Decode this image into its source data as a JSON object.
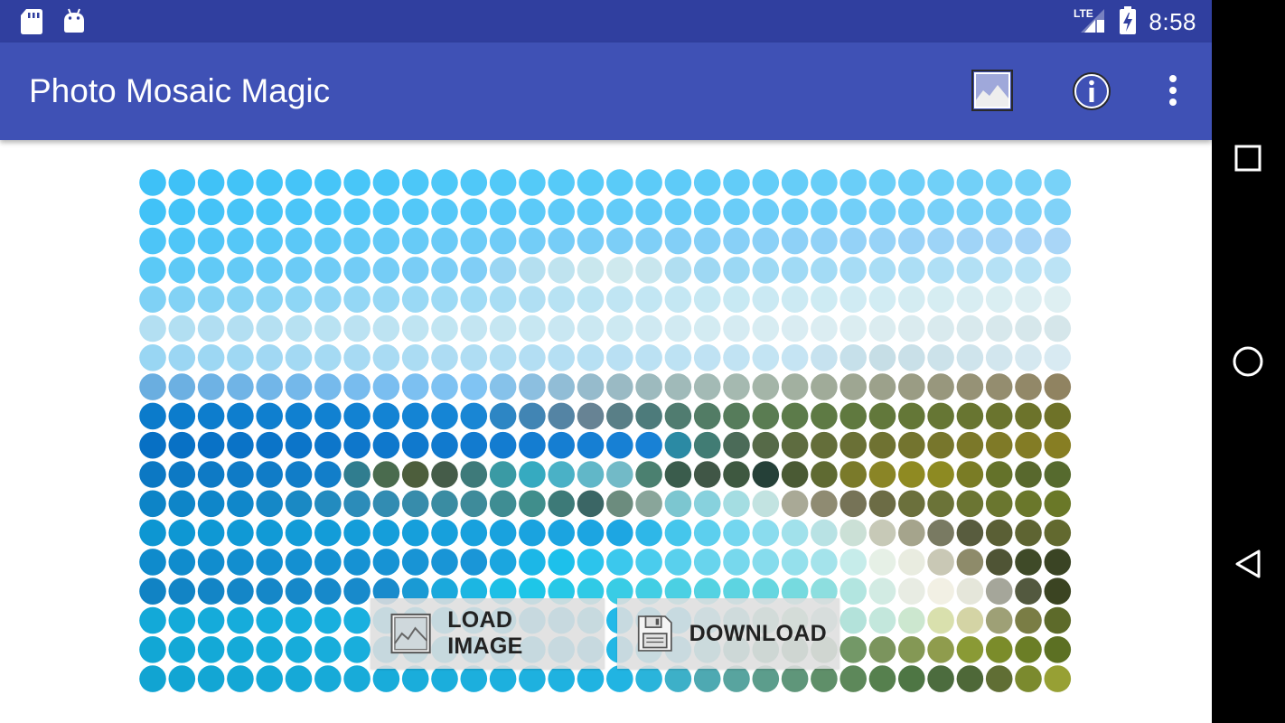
{
  "status_bar": {
    "time": "8:58",
    "network_label": "LTE",
    "icons": [
      "sd-card-icon",
      "android-icon",
      "lte-signal-icon",
      "battery-charging-icon"
    ]
  },
  "app_bar": {
    "title": "Photo Mosaic Magic",
    "actions": [
      "image-icon",
      "info-icon",
      "overflow-menu-icon"
    ]
  },
  "actions": {
    "load_image_label": "LOAD IMAGE",
    "download_label": "DOWNLOAD"
  },
  "nav_bar": {
    "buttons": [
      "recents-square-icon",
      "home-circle-icon",
      "back-triangle-icon"
    ]
  },
  "colors": {
    "primary": "#3f51b5",
    "primary_dark": "#303f9f",
    "nav_background": "#000000",
    "button_background": "#dedede",
    "button_text": "#222222"
  },
  "mosaic": {
    "columns": 32,
    "rows": 18,
    "color_rows": [
      [
        "#3ec1f7",
        "#3fc1f7",
        "#40c2f7",
        "#42c3f7",
        "#44c4f7",
        "#45c4f8",
        "#46c5f8",
        "#48c6f8",
        "#4ac6f8",
        "#4cc7f8",
        "#4ec8f8",
        "#50c8f8",
        "#52c9f8",
        "#54caf8",
        "#56caf8",
        "#58cbf8",
        "#5acbf8",
        "#5ccbf8",
        "#5ecbf8",
        "#60ccf8",
        "#62ccf8",
        "#64cdf8",
        "#66cdf8",
        "#68cef8",
        "#6acef8",
        "#6ccff8",
        "#6ecff8",
        "#70d0f8",
        "#72d0f8",
        "#74d1f8",
        "#76d1f8",
        "#78d2f8"
      ],
      [
        "#41c2f7",
        "#43c3f7",
        "#45c3f7",
        "#47c4f7",
        "#49c5f7",
        "#4bc5f8",
        "#4dc6f8",
        "#4fc7f8",
        "#51c7f8",
        "#53c8f8",
        "#56c8f8",
        "#58c9f8",
        "#5ac9f8",
        "#5ccaf8",
        "#5ecaf8",
        "#60cbf8",
        "#62cbf8",
        "#64cbf8",
        "#66ccf8",
        "#68ccf8",
        "#6acdf8",
        "#6ccdf8",
        "#6ecef8",
        "#70cef8",
        "#72cff8",
        "#74cff8",
        "#76d0f8",
        "#78d0f8",
        "#7ad1f8",
        "#7cd1f8",
        "#7ed2f8",
        "#80d2f8"
      ],
      [
        "#4dc5f7",
        "#4fc6f7",
        "#52c6f7",
        "#55c7f7",
        "#58c8f7",
        "#5bc8f7",
        "#5ec9f7",
        "#61caf7",
        "#64caf7",
        "#67cbf7",
        "#6acbf7",
        "#6dccf7",
        "#70ccf7",
        "#73cdf7",
        "#76cdf7",
        "#79cef7",
        "#7ccef7",
        "#7fcff7",
        "#82cff7",
        "#85d0f7",
        "#88d0f7",
        "#8bd1f7",
        "#8ed1f7",
        "#91d2f7",
        "#94d2f7",
        "#97d3f7",
        "#9ad3f7",
        "#9dd4f7",
        "#a0d4f7",
        "#a3d5f7",
        "#a6d5f7",
        "#a9d6f7"
      ],
      [
        "#5bc9f6",
        "#5ec9f6",
        "#61caf6",
        "#64caf6",
        "#68cbf6",
        "#6bcbf6",
        "#6fccf6",
        "#72ccf6",
        "#75cdf6",
        "#79cdf6",
        "#7ccef6",
        "#80cef6",
        "#9ad6f3",
        "#b4dff0",
        "#bfe3ef",
        "#c9e7ee",
        "#cfe9ee",
        "#c8e6ee",
        "#b0def1",
        "#9ed8f3",
        "#9bd8f4",
        "#9dd9f4",
        "#a0daf5",
        "#a3dbf5",
        "#a6dcf5",
        "#a9ddf5",
        "#acdef5",
        "#afdff5",
        "#b2e0f5",
        "#b5e1f5",
        "#b8e2f5",
        "#bbe3f5"
      ],
      [
        "#7fd1f5",
        "#82d2f5",
        "#85d3f5",
        "#88d4f5",
        "#8bd5f5",
        "#8ed6f5",
        "#91d6f5",
        "#94d7f5",
        "#97d8f5",
        "#9ad9f5",
        "#9ddaf5",
        "#a0dbf5",
        "#a8ddf4",
        "#b0dff3",
        "#b7e2f3",
        "#bce4f3",
        "#c0e5f3",
        "#c2e6f3",
        "#c4e7f3",
        "#c6e8f3",
        "#c8e9f3",
        "#cae9f3",
        "#cceaf3",
        "#ceebf3",
        "#d0ebf3",
        "#d2ecf3",
        "#d4ecf2",
        "#d6edf2",
        "#d8edf2",
        "#daeef2",
        "#dceef2",
        "#deeff2"
      ],
      [
        "#b3dff2",
        "#b2dff2",
        "#b1def2",
        "#b3dff2",
        "#b5e0f2",
        "#b7e1f2",
        "#b9e2f2",
        "#bbe2f2",
        "#bde3f2",
        "#bfe4f2",
        "#c1e5f2",
        "#c3e5f2",
        "#c5e6f2",
        "#c7e7f2",
        "#c9e7f2",
        "#cbe8f2",
        "#cde9f2",
        "#cfe9f2",
        "#d1eaf2",
        "#d3ebf2",
        "#d5ebf2",
        "#d7ecf2",
        "#d9ecf2",
        "#dbedf2",
        "#dbedf1",
        "#dbecf0",
        "#daebef",
        "#d9eaee",
        "#d8e9ed",
        "#d7e8ec",
        "#d6e7eb",
        "#d5e6ea"
      ],
      [
        "#99d6f3",
        "#9bd6f3",
        "#9dd7f3",
        "#9fd8f3",
        "#a1d8f3",
        "#a3d9f3",
        "#a5daf3",
        "#a7daf3",
        "#a9dbf3",
        "#abdcf3",
        "#addcf3",
        "#afddf3",
        "#b1def3",
        "#b3def3",
        "#b5dff3",
        "#b7e0f3",
        "#b9e0f3",
        "#bbe1f3",
        "#bde2f3",
        "#bfe2f3",
        "#c1e3f3",
        "#c3e4f3",
        "#c5e4f3",
        "#c6e2ef",
        "#c6e0ea",
        "#c6deе6",
        "#c9e0e8",
        "#cce2ea",
        "#cfe4ec",
        "#d2e6ee",
        "#d5e8f0",
        "#d8eaf2"
      ],
      [
        "#6aaee0",
        "#6cb0e2",
        "#6eb2e4",
        "#70b4e6",
        "#72b6e8",
        "#74b8ea",
        "#76baec",
        "#78bcee",
        "#7abef0",
        "#7cc0f1",
        "#7ec2f2",
        "#80c4f3",
        "#86c2ea",
        "#8cbfe0",
        "#91bdd6",
        "#96bbcc",
        "#9abac4",
        "#9dbabe",
        "#a0bab9",
        "#a3bab5",
        "#a5b9b0",
        "#a4b5a8",
        "#a2b0a0",
        "#a0ab99",
        "#9ea692",
        "#9ca18b",
        "#9a9c84",
        "#98977d",
        "#969276",
        "#948d6f",
        "#928868",
        "#908361"
      ],
      [
        "#0b7bcb",
        "#0c7ccc",
        "#0d7dcd",
        "#0e7ece",
        "#0f7fcf",
        "#1080d0",
        "#1181d1",
        "#1282d2",
        "#1383d3",
        "#1484d4",
        "#1585d5",
        "#1986d4",
        "#2d86c4",
        "#4185b4",
        "#5484a4",
        "#678394",
        "#597f87",
        "#4d7b7b",
        "#507c70",
        "#527c65",
        "#567c5b",
        "#5a7c52",
        "#5c7b4a",
        "#5e7a44",
        "#60793f",
        "#62783b",
        "#647737",
        "#667634",
        "#687531",
        "#6a742e",
        "#6c732b",
        "#6e7228"
      ],
      [
        "#0770c4",
        "#0871c5",
        "#0972c6",
        "#0a73c7",
        "#0b74c8",
        "#0c75c9",
        "#0d76ca",
        "#0e77cb",
        "#0f78cc",
        "#1079cd",
        "#117ace",
        "#127bcf",
        "#137cd0",
        "#147dd1",
        "#157ed2",
        "#167fd3",
        "#1780d4",
        "#1881d5",
        "#2b8aa4",
        "#417c74",
        "#4b6b58",
        "#566a48",
        "#5e6c40",
        "#646e3a",
        "#6a7036",
        "#6f7232",
        "#73742f",
        "#77762c",
        "#7b7829",
        "#7f7a27",
        "#837c25",
        "#877e23"
      ],
      [
        "#0c78c3",
        "#0d79c4",
        "#0e7ac5",
        "#0f7bc6",
        "#107cc7",
        "#117dc8",
        "#127ec9",
        "#307d8f",
        "#4a6b4e",
        "#4d5e3c",
        "#455c49",
        "#3e7a7a",
        "#3a9aa4",
        "#36aac0",
        "#4ab1c6",
        "#61b7c8",
        "#72bac7",
        "#4b8070",
        "#3a5c4c",
        "#405646",
        "#3e5840",
        "#254038",
        "#4a5a34",
        "#5f6a32",
        "#7a7a2a",
        "#8a8526",
        "#8f8a22",
        "#8d8a22",
        "#7a7c25",
        "#64722a",
        "#58682d",
        "#566a2e"
      ],
      [
        "#0d84c7",
        "#0e85c8",
        "#0f86c9",
        "#1087ca",
        "#1588c7",
        "#1a89c4",
        "#238bbf",
        "#2c8cb9",
        "#328cb2",
        "#378cab",
        "#3a8ca2",
        "#3e8b9a",
        "#3f8d93",
        "#408e8c",
        "#3d7a78",
        "#3b6665",
        "#6c8c7e",
        "#89a59a",
        "#7cc6d0",
        "#87d1dd",
        "#a4dde2",
        "#c2e3e1",
        "#a9a996",
        "#8f8b72",
        "#767357",
        "#6c6c45",
        "#6b703c",
        "#6b7338",
        "#6b7533",
        "#6a762f",
        "#6a772b",
        "#6a7828"
      ],
      [
        "#0d96d2",
        "#0e97d3",
        "#0f98d4",
        "#1099d5",
        "#119ad6",
        "#129bd7",
        "#139cd8",
        "#149dd9",
        "#159eda",
        "#169fdb",
        "#17a0dc",
        "#18a1dd",
        "#19a2de",
        "#1aa3df",
        "#1ba4e0",
        "#1ca5e1",
        "#1da6e2",
        "#2eb7e8",
        "#45c6ec",
        "#5ccfee",
        "#73d6ef",
        "#8adcee",
        "#a1e1eb",
        "#b8e2e4",
        "#cbe0d6",
        "#c7c9b7",
        "#a5a48c",
        "#797a62",
        "#585c3e",
        "#5a5f35",
        "#5e6432",
        "#62692f"
      ],
      [
        "#0f8bcc",
        "#108ccd",
        "#118dce",
        "#128ecf",
        "#138fd0",
        "#1490d1",
        "#1591d2",
        "#1692d3",
        "#1793d4",
        "#1894d5",
        "#1995d6",
        "#1a96d7",
        "#1ba6df",
        "#1cb7e7",
        "#1dc0eb",
        "#2cc4ec",
        "#3bc8ed",
        "#4acced",
        "#59d0ed",
        "#68d4ed",
        "#77d8ed",
        "#86dced",
        "#95e0ec",
        "#a4e3eb",
        "#c6ecea",
        "#e6f0e6",
        "#e9ece0",
        "#c9c8b5",
        "#8e8b6a",
        "#4f5435",
        "#3f4a28",
        "#3a4424"
      ],
      [
        "#1183c4",
        "#1284c5",
        "#1385c6",
        "#1486c7",
        "#1587c8",
        "#1688c9",
        "#1789ca",
        "#188acb",
        "#198bcc",
        "#1a9ad4",
        "#1ba9dc",
        "#1cb6e2",
        "#1dbfe6",
        "#1ec6e8",
        "#27c8e7",
        "#30cae6",
        "#39cce5",
        "#42cee4",
        "#4bd0e3",
        "#54d2e2",
        "#5dd4e1",
        "#66d6e0",
        "#76dadf",
        "#8ddedf",
        "#b2e5e0",
        "#d2ebe3",
        "#e8ece3",
        "#f2f0e4",
        "#e5e6da",
        "#a5a69a",
        "#53593f",
        "#3b4422"
      ],
      [
        "#13a9d8",
        "#14aad9",
        "#15abda",
        "#16acdb",
        "#17addc",
        "#18aedd",
        "#19afde",
        "#1ab0df",
        "#1bb1e0",
        "#1cb2e1",
        "#1db3e2",
        "#1eb4e3",
        "#1fb5e4",
        "#20b6e5",
        "#21b7e6",
        "#22b8e7",
        "#23b9e8",
        "#24bae9",
        "#25bbea",
        "#5fc9e2",
        "#66c4ca",
        "#7cc5b7",
        "#8dc8aa",
        "#a5d6cf",
        "#b3e2da",
        "#c3e7dc",
        "#cce7cf",
        "#d9e0ad",
        "#d4d4a5",
        "#9ea076",
        "#7a7d45",
        "#5d6a2a"
      ],
      [
        "#12a7d5",
        "#13a8d6",
        "#14a9d7",
        "#15aad8",
        "#16abd9",
        "#17acda",
        "#18addb",
        "#19aedc",
        "#1aafdd",
        "#1bb0de",
        "#1cb1df",
        "#1db2e0",
        "#1eb3e1",
        "#1fb4e2",
        "#20b5e3",
        "#21b6e4",
        "#22b7e5",
        "#23b8e6",
        "#36bfe5",
        "#43b8c8",
        "#51aca7",
        "#5aa38f",
        "#609d7f",
        "#699a72",
        "#739867",
        "#7b945d",
        "#849855",
        "#8f9c4d",
        "#8a9a35",
        "#7b8c2a",
        "#6b7e26",
        "#5c7023"
      ],
      [
        "#11a4d2",
        "#12a5d3",
        "#13a6d4",
        "#14a7d5",
        "#15a8d6",
        "#16a9d7",
        "#17aad8",
        "#18abd9",
        "#19acda",
        "#1aaddb",
        "#1baedc",
        "#1cafdd",
        "#1db0de",
        "#1eb1df",
        "#1fb2e0",
        "#20b3e1",
        "#21b4e2",
        "#2ab4db",
        "#3db0c8",
        "#4ea9b2",
        "#58a49f",
        "#5c9d8c",
        "#5f967a",
        "#5f8f69",
        "#5d885a",
        "#56804e",
        "#4e7644",
        "#4c6c3e",
        "#4e6838",
        "#606e34",
        "#7b8a2e",
        "#97a034"
      ]
    ]
  }
}
